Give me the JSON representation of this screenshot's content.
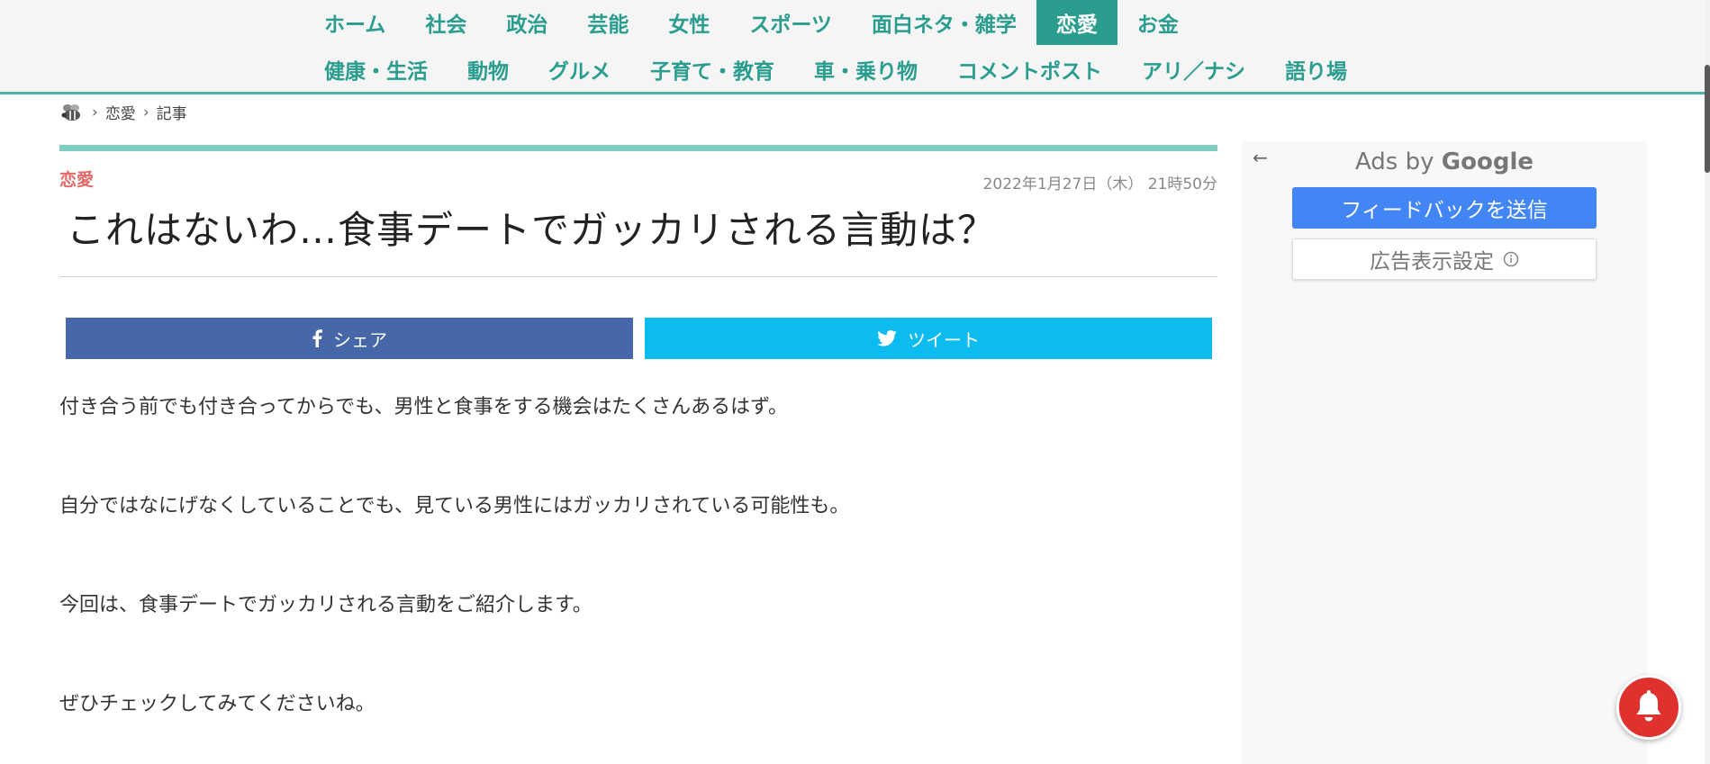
{
  "nav": {
    "row1": [
      "ホーム",
      "社会",
      "政治",
      "芸能",
      "女性",
      "スポーツ",
      "面白ネタ・雑学",
      "恋愛",
      "お金"
    ],
    "row2": [
      "健康・生活",
      "動物",
      "グルメ",
      "子育て・教育",
      "車・乗り物",
      "コメントポスト",
      "アリ／ナシ",
      "語り場"
    ],
    "active": "恋愛",
    "active_color": "#2a9d8f"
  },
  "breadcrumb": {
    "items": [
      "恋愛",
      "記事"
    ],
    "separator": "›"
  },
  "article": {
    "category": "恋愛",
    "date": "2022年1月27日（木） 21時50分",
    "title": "これはないわ…食事デートでガッカリされる言動は？",
    "share_facebook": "シェア",
    "share_twitter": "ツイート",
    "paragraphs": [
      "付き合う前でも付き合ってからでも、男性と食事をする機会はたくさんあるはず。",
      "自分ではなにげなくしていることでも、見ている男性にはガッカリされている可能性も。",
      "今回は、食事デートでガッカリされる言動をご紹介します。",
      "ぜひチェックしてみてくださいね。"
    ]
  },
  "ad": {
    "ads_by": "Ads by",
    "google": "Google",
    "feedback_button": "フィードバックを送信",
    "settings_button": "広告表示設定"
  },
  "colors": {
    "facebook": "#4667a8",
    "twitter": "#0cbbef",
    "category": "#e46a6a",
    "accent_bar": "#7fcdc3",
    "bell": "#e0312f"
  }
}
